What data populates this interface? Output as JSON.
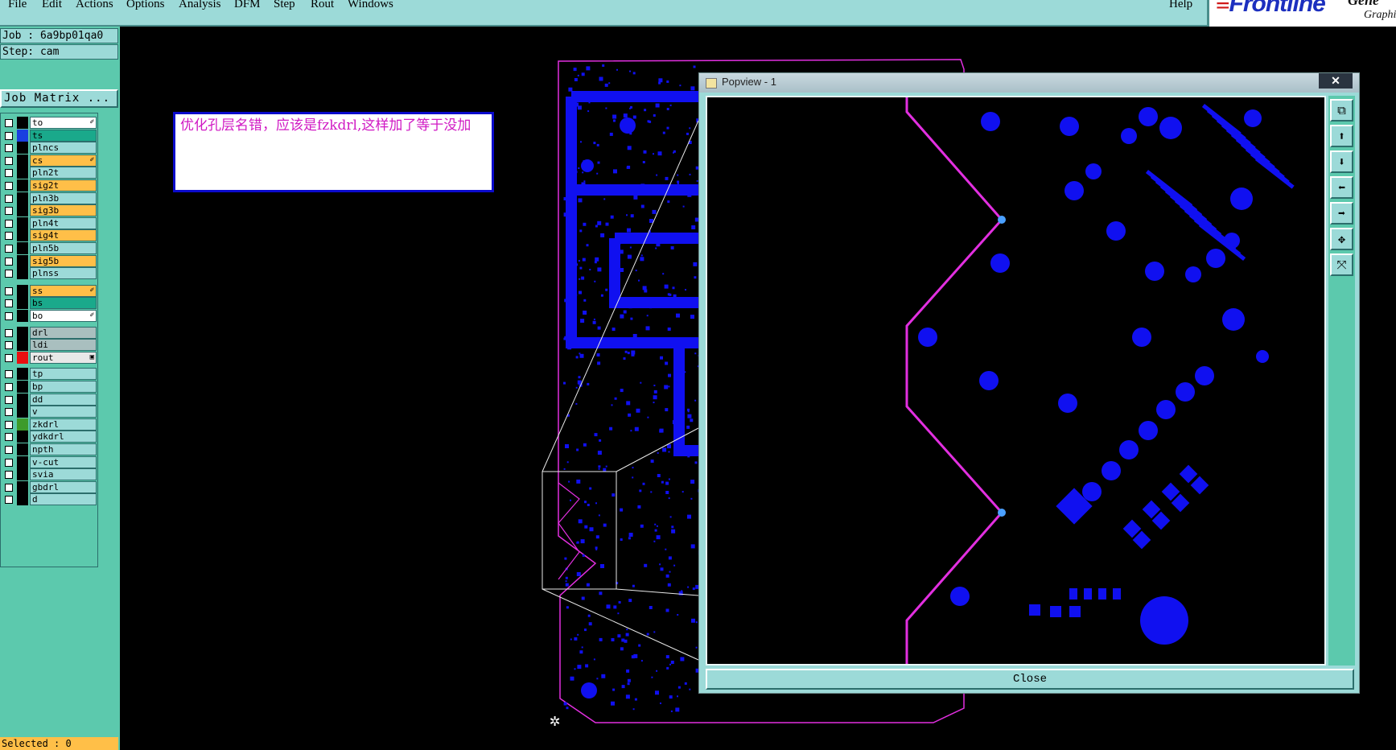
{
  "menu": {
    "file": "File",
    "edit": "Edit",
    "actions": "Actions",
    "options": "Options",
    "analysis": "Analysis",
    "dfm": "DFM",
    "step": "Step",
    "rout": "Rout",
    "windows": "Windows",
    "help": "Help"
  },
  "brand": {
    "name": "Frontline",
    "side": "Gene",
    "sub": "Graphi"
  },
  "job": {
    "job_label": "Job : 6a9bp01qa0",
    "step_label": "Step: cam",
    "matrix_button": "Job Matrix ..."
  },
  "layers": [
    {
      "name": "to",
      "style": "white",
      "swatch": "#000000",
      "mark": "✐"
    },
    {
      "name": "ts",
      "style": "teal",
      "swatch": "#1a3fe0",
      "mark": ""
    },
    {
      "name": "plncs",
      "style": "",
      "swatch": "#000000",
      "mark": ""
    },
    {
      "name": "cs",
      "style": "orange",
      "swatch": "#000000",
      "mark": "✐"
    },
    {
      "name": "pln2t",
      "style": "",
      "swatch": "#000000",
      "mark": ""
    },
    {
      "name": "sig2t",
      "style": "orange",
      "swatch": "#000000",
      "mark": ""
    },
    {
      "name": "pln3b",
      "style": "",
      "swatch": "#000000",
      "mark": ""
    },
    {
      "name": "sig3b",
      "style": "orange",
      "swatch": "#000000",
      "mark": ""
    },
    {
      "name": "pln4t",
      "style": "",
      "swatch": "#000000",
      "mark": ""
    },
    {
      "name": "sig4t",
      "style": "orange",
      "swatch": "#000000",
      "mark": ""
    },
    {
      "name": "pln5b",
      "style": "",
      "swatch": "#000000",
      "mark": ""
    },
    {
      "name": "sig5b",
      "style": "orange",
      "swatch": "#000000",
      "mark": ""
    },
    {
      "name": "plnss",
      "style": "",
      "swatch": "#000000",
      "mark": ""
    },
    {
      "name": "ss",
      "style": "orange",
      "swatch": "#000000",
      "mark": "✐"
    },
    {
      "name": "bs",
      "style": "teal",
      "swatch": "#000000",
      "mark": ""
    },
    {
      "name": "bo",
      "style": "white",
      "swatch": "#000000",
      "mark": "✐"
    },
    {
      "name": "drl",
      "style": "grey",
      "swatch": "#000000",
      "mark": ""
    },
    {
      "name": "ldi",
      "style": "grey",
      "swatch": "#000000",
      "mark": ""
    },
    {
      "name": "rout",
      "style": "lgrey",
      "swatch": "#e81010",
      "mark": "▣"
    },
    {
      "name": "tp",
      "style": "",
      "swatch": "#000000",
      "mark": ""
    },
    {
      "name": "bp",
      "style": "",
      "swatch": "#000000",
      "mark": ""
    },
    {
      "name": "dd",
      "style": "",
      "swatch": "#000000",
      "mark": ""
    },
    {
      "name": "v",
      "style": "",
      "swatch": "#000000",
      "mark": ""
    },
    {
      "name": "zkdrl",
      "style": "",
      "swatch": "#3d9b2a",
      "mark": ""
    },
    {
      "name": "ydkdrl",
      "style": "",
      "swatch": "#000000",
      "mark": ""
    },
    {
      "name": "npth",
      "style": "",
      "swatch": "#000000",
      "mark": ""
    },
    {
      "name": "v-cut",
      "style": "",
      "swatch": "#000000",
      "mark": ""
    },
    {
      "name": "svia",
      "style": "",
      "swatch": "#000000",
      "mark": ""
    },
    {
      "name": "gbdrl",
      "style": "",
      "swatch": "#000000",
      "mark": ""
    },
    {
      "name": "d",
      "style": "",
      "swatch": "#000000",
      "mark": ""
    }
  ],
  "status": {
    "selected": "Selected : 0"
  },
  "note": {
    "text": "优化孔层名错，应该是fzkdrl,这样加了等于没加"
  },
  "popup": {
    "title": "Popview - 1",
    "close_x": "✕",
    "close_button": "Close"
  },
  "colors": {
    "pad": "#1010f0",
    "outline": "#e22fe0",
    "panel": "#5cc9ad",
    "field": "#9cdad8"
  },
  "icons": {
    "popup_tools": [
      "zoom-window-icon",
      "pan-up-icon",
      "pan-down-icon",
      "pan-left-icon",
      "pan-right-icon",
      "zoom-in-icon",
      "zoom-fit-icon"
    ]
  }
}
